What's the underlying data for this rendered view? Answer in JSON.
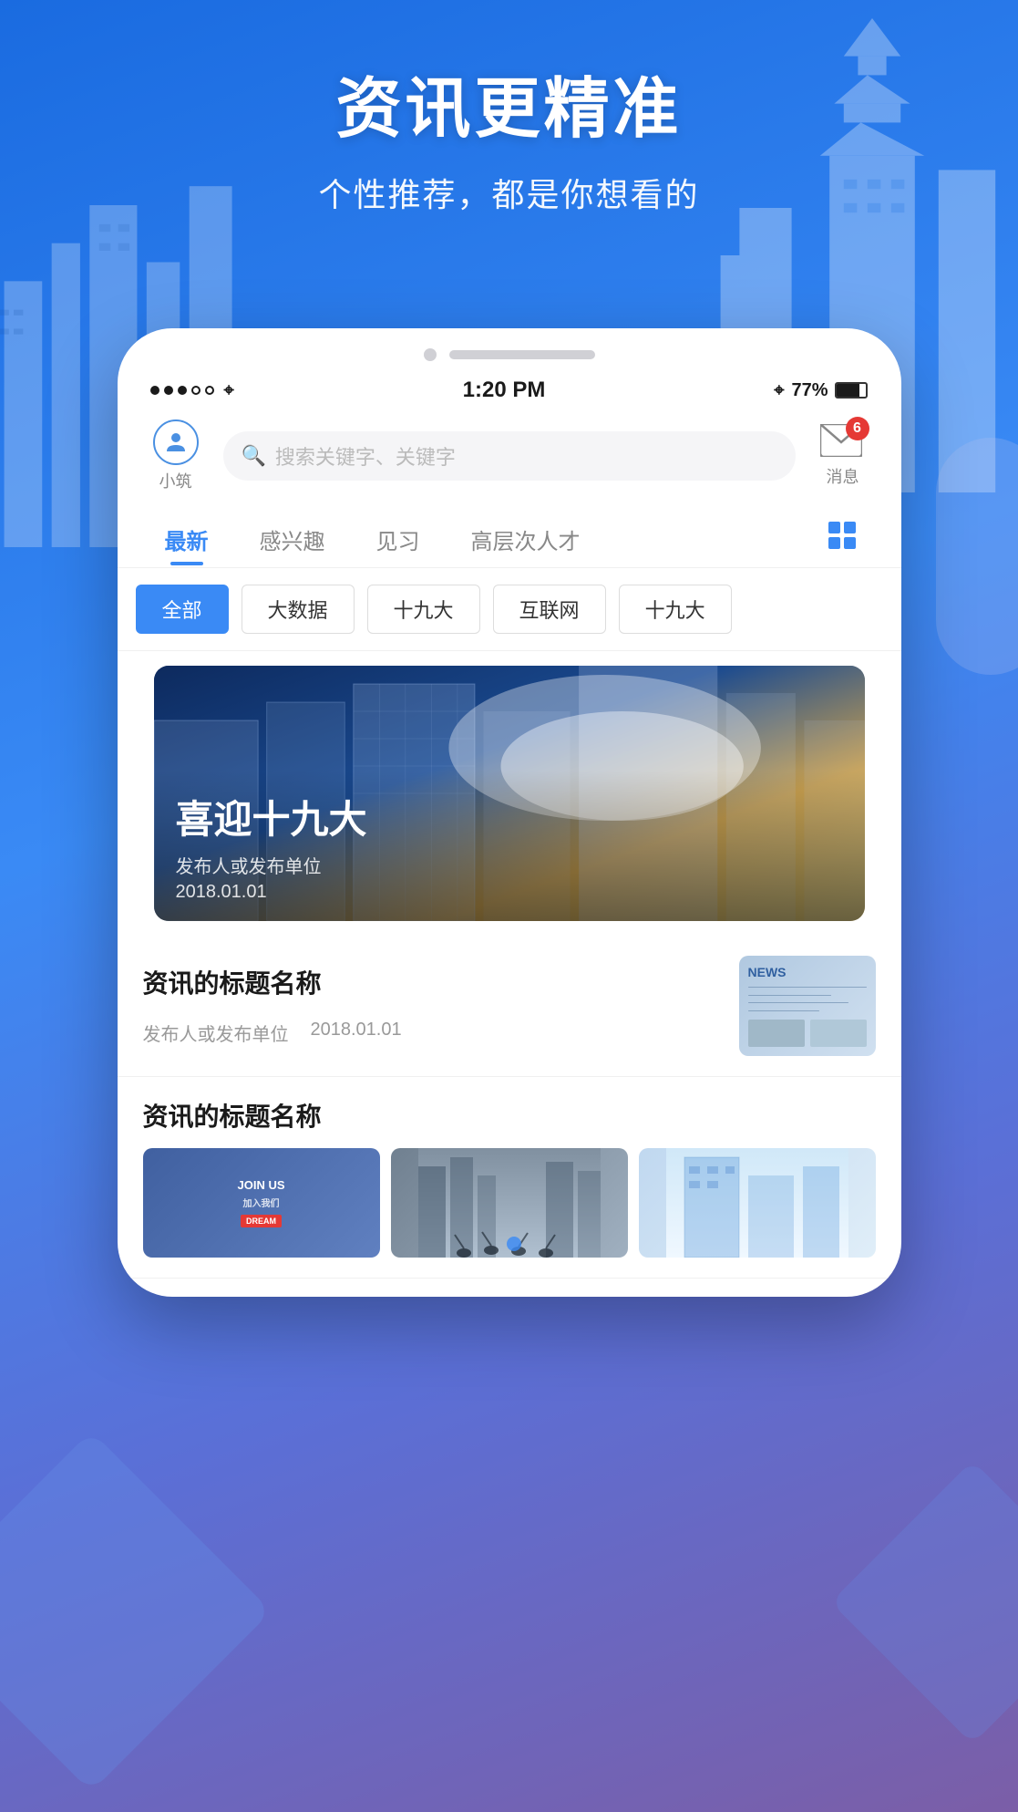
{
  "background": {
    "color_top": "#1a6be0",
    "color_bottom": "#7b5ea7"
  },
  "header": {
    "title": "资讯更精准",
    "subtitle": "个性推荐，都是你想看的"
  },
  "status_bar": {
    "time": "1:20 PM",
    "battery_percent": "77%",
    "signal_dots": "●●●○○",
    "wifi": "WiFi",
    "bluetooth": "BT"
  },
  "nav": {
    "user_icon_label": "小筑",
    "search_placeholder": "搜索关键字、关键字",
    "message_label": "消息",
    "message_badge": "6"
  },
  "tabs": [
    {
      "id": "latest",
      "label": "最新",
      "active": true
    },
    {
      "id": "interest",
      "label": "感兴趣",
      "active": false
    },
    {
      "id": "internship",
      "label": "见习",
      "active": false
    },
    {
      "id": "senior",
      "label": "高层次人才",
      "active": false
    }
  ],
  "categories": [
    {
      "id": "all",
      "label": "全部",
      "active": true
    },
    {
      "id": "bigdata",
      "label": "大数据",
      "active": false
    },
    {
      "id": "party19a",
      "label": "十九大",
      "active": false
    },
    {
      "id": "internet",
      "label": "互联网",
      "active": false
    },
    {
      "id": "party19b",
      "label": "十九大",
      "active": false
    }
  ],
  "banner": {
    "title": "喜迎十九大",
    "publisher": "发布人或发布单位",
    "date": "2018.01.01"
  },
  "news_items": [
    {
      "id": "news1",
      "title": "资讯的标题名称",
      "publisher": "发布人或发布单位",
      "date": "2018.01.01",
      "has_thumb": true,
      "thumb_type": "newspaper"
    },
    {
      "id": "news2",
      "title": "资讯的标题名称",
      "publisher": "",
      "date": "",
      "has_multi_images": true,
      "images": [
        "join_us",
        "crowd",
        "building_blue"
      ]
    }
  ]
}
